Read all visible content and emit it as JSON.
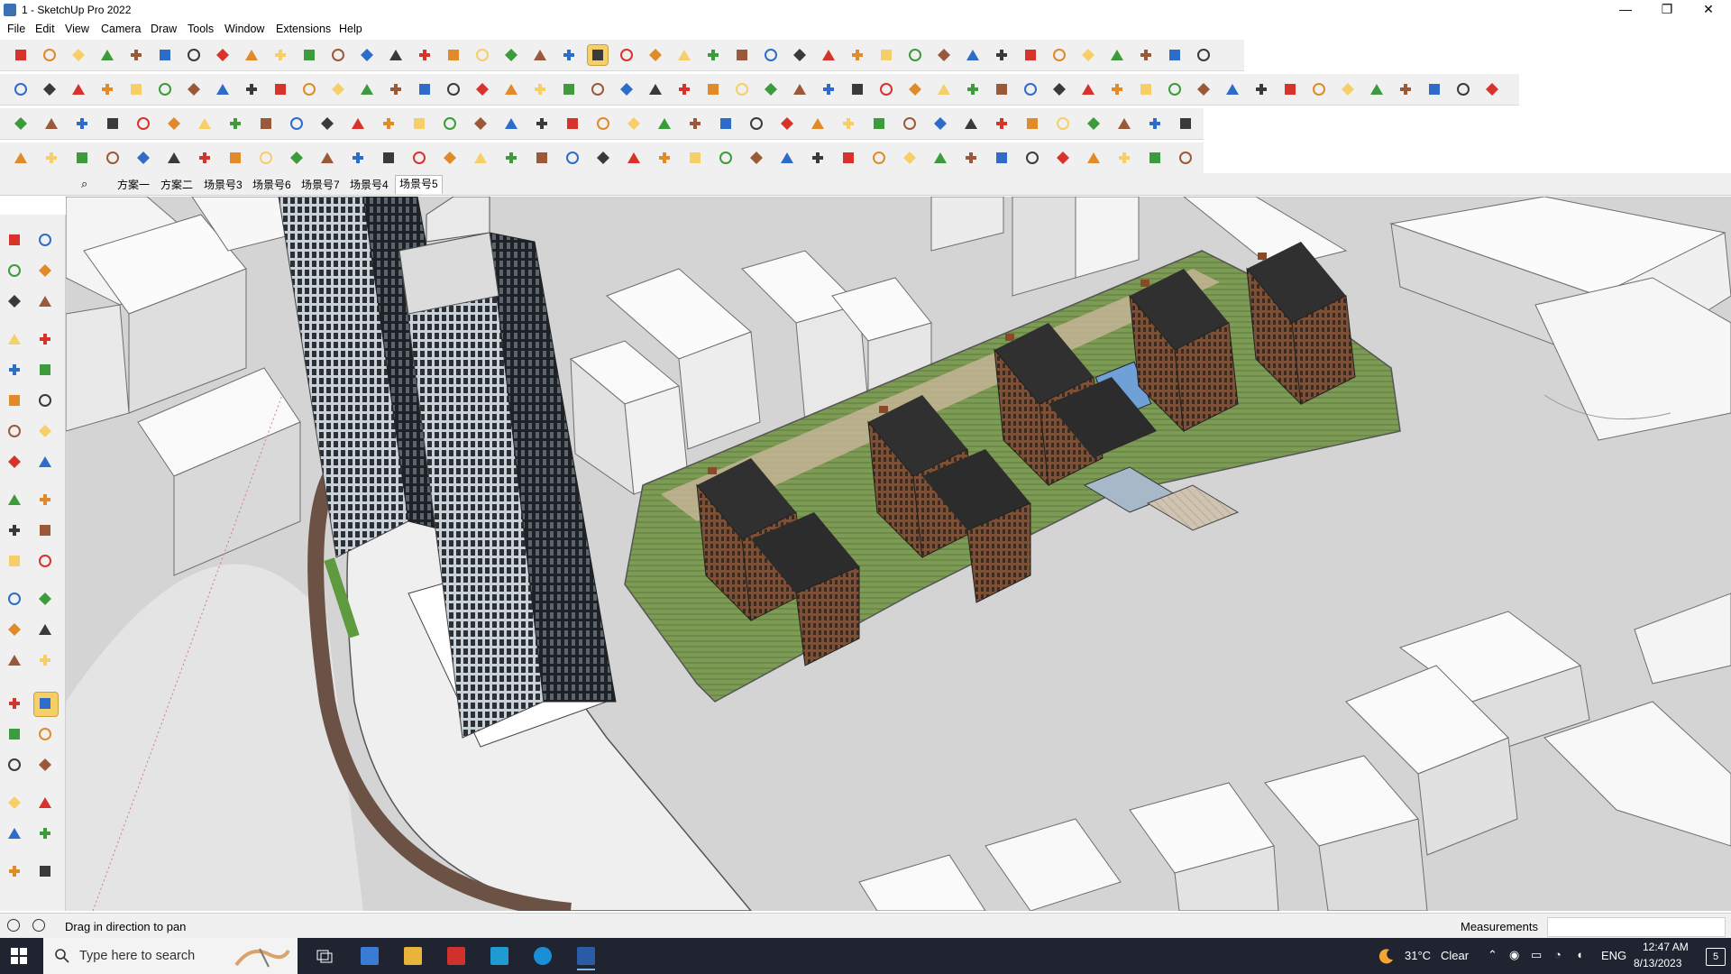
{
  "window": {
    "title": "1 - SketchUp Pro 2022",
    "minimize_glyph": "—",
    "maximize_glyph": "❐",
    "close_glyph": "✕"
  },
  "menu": [
    "File",
    "Edit",
    "View",
    "Camera",
    "Draw",
    "Tools",
    "Window",
    "Extensions",
    "Help"
  ],
  "scenes": {
    "tabs": [
      "方案一",
      "方案二",
      "场景号3",
      "场景号6",
      "场景号7",
      "场景号4",
      "场景号5"
    ],
    "active_index": 6
  },
  "toolbars": {
    "accent_colors": {
      "red": "#d8332b",
      "blue": "#2e6cc9",
      "green": "#3c9b3a",
      "orange": "#e08a2a",
      "yellow_selected": "#f6cf68",
      "dark": "#3a3a3a",
      "brown": "#9a5a3a"
    }
  },
  "status": {
    "hint": "Drag in direction to pan",
    "measurements_label": "Measurements",
    "measurements_value": ""
  },
  "taskbar": {
    "search_placeholder": "Type here to search",
    "weather_temp": "31°C",
    "weather_text": "Clear",
    "language": "ENG",
    "time": "12:47 AM",
    "date": "8/13/2023",
    "notification_count": "5"
  }
}
